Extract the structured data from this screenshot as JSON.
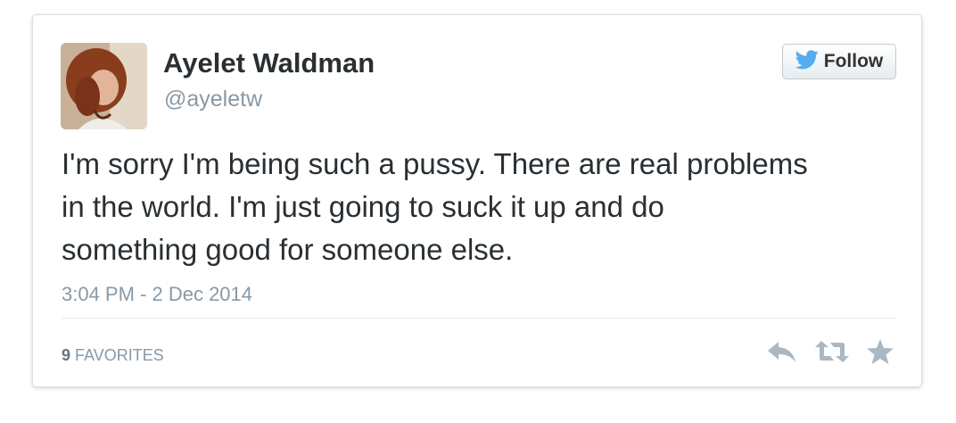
{
  "user": {
    "name": "Ayelet Waldman",
    "handle": "@ayeletw"
  },
  "follow_button": {
    "label": "Follow",
    "icon": "twitter-bird-icon"
  },
  "tweet": {
    "text": "I'm sorry I'm being such a pussy. There are real problems\nin the world. I'm just going to suck it up and do\nsomething good for someone else.",
    "timestamp": "3:04 PM - 2 Dec 2014"
  },
  "stats": {
    "favorites_count": "9",
    "favorites_label": "FAVORITES"
  },
  "actions": [
    "reply-icon",
    "retweet-icon",
    "favorite-star-icon"
  ],
  "colors": {
    "twitter_blue": "#55acee",
    "text": "#292f33",
    "muted": "#8899a6",
    "action_icon": "#aab8c2"
  }
}
